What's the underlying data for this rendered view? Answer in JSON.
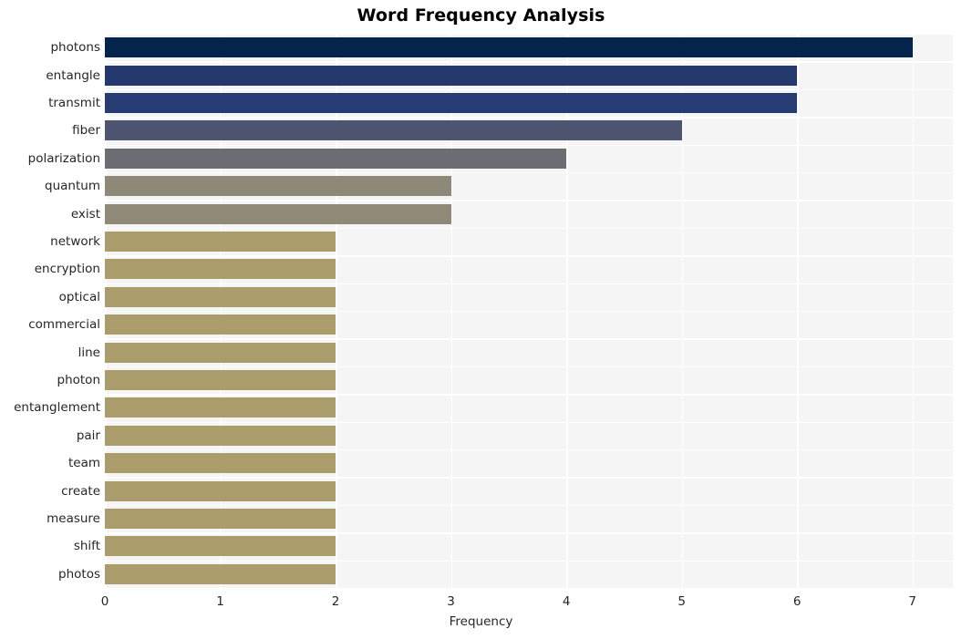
{
  "chart_data": {
    "type": "bar",
    "orientation": "horizontal",
    "title": "Word Frequency Analysis",
    "xlabel": "Frequency",
    "ylabel": "",
    "xlim": [
      0,
      7.35
    ],
    "xticks": [
      0,
      1,
      2,
      3,
      4,
      5,
      6,
      7
    ],
    "xticklabels": [
      "0",
      "1",
      "2",
      "3",
      "4",
      "5",
      "6",
      "7"
    ],
    "grid": true,
    "legend": false,
    "categories": [
      "photons",
      "entangle",
      "transmit",
      "fiber",
      "polarization",
      "quantum",
      "exist",
      "network",
      "encryption",
      "optical",
      "commercial",
      "line",
      "photon",
      "entanglement",
      "pair",
      "team",
      "create",
      "measure",
      "shift",
      "photos"
    ],
    "values": [
      7,
      6,
      6,
      5,
      4,
      3,
      3,
      2,
      2,
      2,
      2,
      2,
      2,
      2,
      2,
      2,
      2,
      2,
      2,
      2
    ],
    "bar_colors": [
      "#04244c",
      "#24386e",
      "#273c72",
      "#4d5570",
      "#6b6d73",
      "#8e8878",
      "#8f8a77",
      "#ab9d6b",
      "#ab9d6b",
      "#ab9d6b",
      "#ab9d6b",
      "#ab9d6b",
      "#ab9d6b",
      "#ab9d6b",
      "#ab9d6b",
      "#ab9d6b",
      "#ab9d6b",
      "#ab9d6b",
      "#ab9d6b",
      "#ab9d6b"
    ],
    "plot_background": "#f5f5f5",
    "grid_color": "#ffffff",
    "figure_background": "#ffffff",
    "text_color": "#262626"
  }
}
